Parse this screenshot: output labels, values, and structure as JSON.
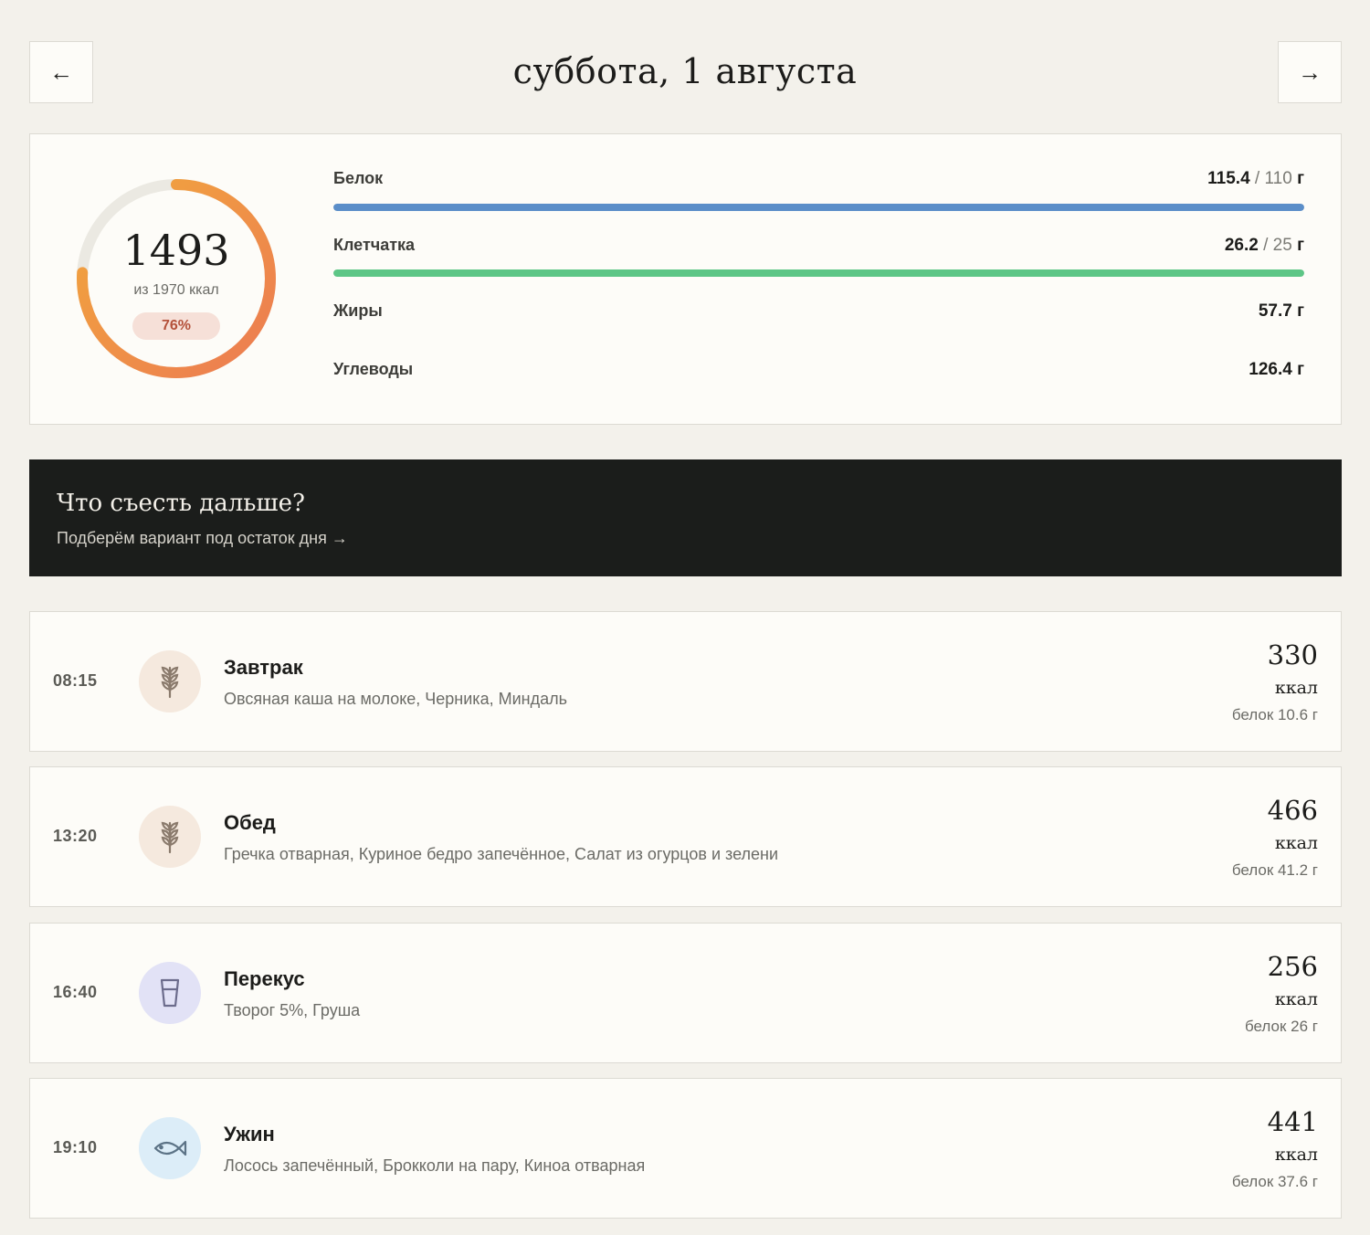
{
  "header": {
    "date": "суббота, 1 августа",
    "prev_label": "←",
    "next_label": "→"
  },
  "summary": {
    "calories": "1493",
    "calories_sub": "из 1970 ккал",
    "percent_label": "76%",
    "percent_value": 0.76,
    "ring_colors": {
      "track": "#ebe9e2",
      "start": "#ec7b52",
      "end": "#f2a83c"
    },
    "nutrients": [
      {
        "label": "Белок",
        "value": "115.4",
        "target": " / 110",
        "unit": " г",
        "progress": 1.0,
        "color": "#5b8ec9"
      },
      {
        "label": "Клетчатка",
        "value": "26.2",
        "target": " / 25",
        "unit": " г",
        "progress": 1.0,
        "color": "#5dc686"
      },
      {
        "label": "Жиры",
        "value": "57.7",
        "target": "",
        "unit": " г"
      },
      {
        "label": "Углеводы",
        "value": "126.4",
        "target": "",
        "unit": " г"
      }
    ]
  },
  "cta": {
    "title": "Что съесть дальше?",
    "subtitle": "Подберём вариант под остаток дня →"
  },
  "meals": [
    {
      "time": "08:15",
      "name": "Завтрак",
      "items": "Овсяная каша на молоке, Черника, Миндаль",
      "kcal": "330",
      "kcal_unit": "ккал",
      "protein": "белок 10.6 г",
      "icon": "wheat-icon",
      "icon_bg": "#f5e9de"
    },
    {
      "time": "13:20",
      "name": "Обед",
      "items": "Гречка отварная, Куриное бедро запечённое, Салат из огурцов и зелени",
      "kcal": "466",
      "kcal_unit": "ккал",
      "protein": "белок 41.2 г",
      "icon": "wheat-icon",
      "icon_bg": "#f5e9de"
    },
    {
      "time": "16:40",
      "name": "Перекус",
      "items": "Творог 5%, Груша",
      "kcal": "256",
      "kcal_unit": "ккал",
      "protein": "белок 26 г",
      "icon": "glass-icon",
      "icon_bg": "#e2e2f6"
    },
    {
      "time": "19:10",
      "name": "Ужин",
      "items": "Лосось запечённый, Брокколи на пару, Киноа отварная",
      "kcal": "441",
      "kcal_unit": "ккал",
      "protein": "белок 37.6 г",
      "icon": "fish-icon",
      "icon_bg": "#dcedf8"
    }
  ]
}
